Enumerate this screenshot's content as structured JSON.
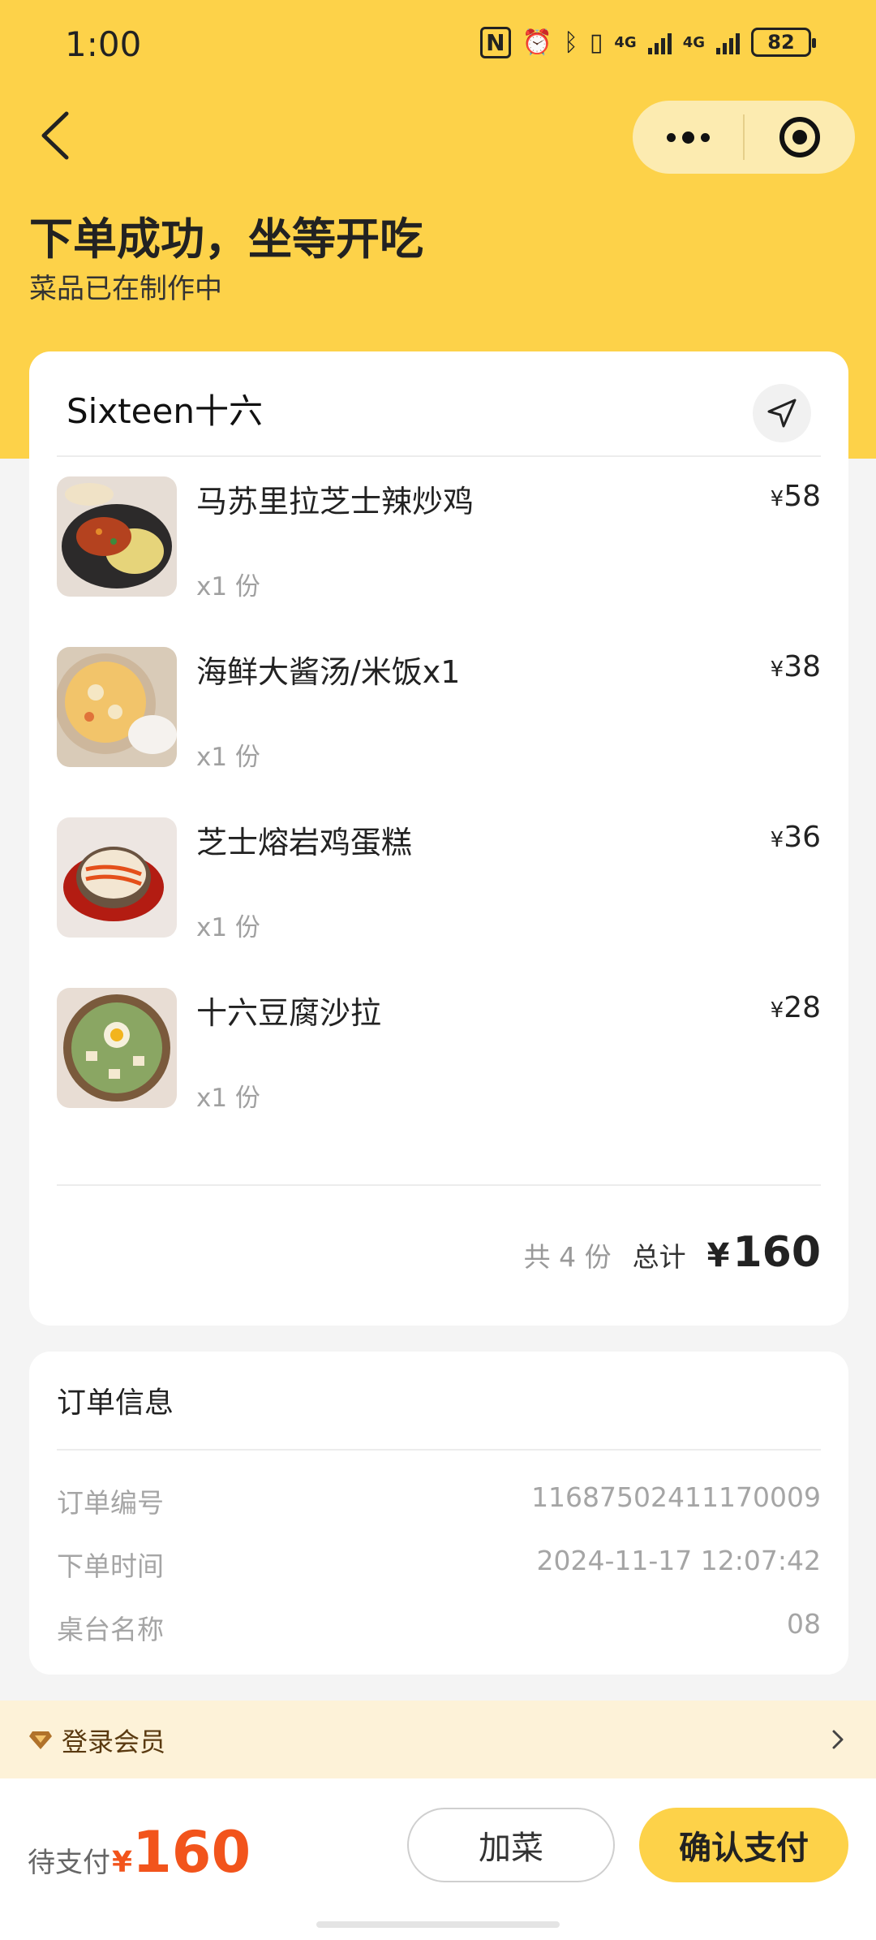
{
  "status_bar": {
    "time": "1:00",
    "battery": "82",
    "net1": "4G",
    "net2": "4G"
  },
  "header": {
    "title": "下单成功，坐等开吃",
    "subtitle": "菜品已在制作中"
  },
  "store": {
    "name": "Sixteen十六"
  },
  "items": [
    {
      "name": "马苏里拉芝士辣炒鸡",
      "qty": "x1 份",
      "price": "58"
    },
    {
      "name": "海鲜大酱汤/米饭x1",
      "qty": "x1 份",
      "price": "38"
    },
    {
      "name": "芝士熔岩鸡蛋糕",
      "qty": "x1 份",
      "price": "36"
    },
    {
      "name": "十六豆腐沙拉",
      "qty": "x1 份",
      "price": "28"
    }
  ],
  "currency": "¥",
  "summary": {
    "count": "共 4 份",
    "total_label": "总计",
    "total": "160"
  },
  "order_info": {
    "title": "订单信息",
    "rows": [
      {
        "label": "订单编号",
        "value": "11687502411170009"
      },
      {
        "label": "下单时间",
        "value": "2024-11-17 12:07:42"
      },
      {
        "label": "桌台名称",
        "value": "08"
      }
    ]
  },
  "member": {
    "label": "登录会员"
  },
  "bottom": {
    "pay_label": "待支付",
    "pay_amount": "160",
    "add_button": "加菜",
    "confirm_button": "确认支付"
  },
  "colors": {
    "brand_yellow": "#fdd249",
    "price_orange": "#f2541c",
    "member_bg": "#fdf2d8"
  },
  "icons": [
    "back-arrow-icon",
    "more-dots-icon",
    "target-icon",
    "locate-arrow-icon",
    "diamond-icon",
    "chevron-right-icon"
  ]
}
